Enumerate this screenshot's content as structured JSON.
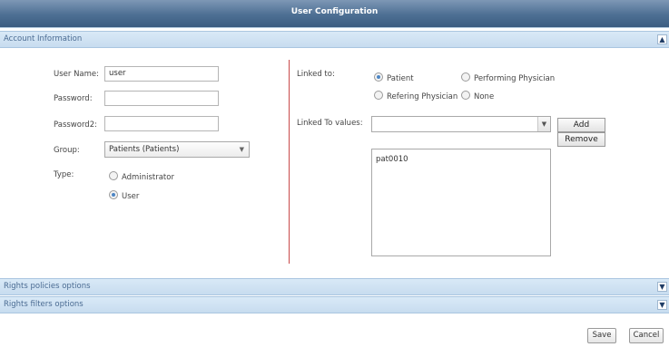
{
  "window": {
    "title": "User Configuration"
  },
  "sections": {
    "account": {
      "label": "Account Information",
      "chevron": "▲"
    },
    "rights_policies": {
      "label": "Rights policies options",
      "chevron": "▼"
    },
    "rights_filters": {
      "label": "Rights filters options",
      "chevron": "▼"
    }
  },
  "form": {
    "username_label": "User Name:",
    "username_value": "user",
    "password_label": "Password:",
    "password_value": "",
    "password2_label": "Password2:",
    "password2_value": "",
    "group_label": "Group:",
    "group_value": "Patients (Patients)",
    "type_label": "Type:",
    "type_options": [
      {
        "label": "Administrator",
        "selected": false
      },
      {
        "label": "User",
        "selected": true
      }
    ]
  },
  "linked": {
    "linked_to_label": "Linked to:",
    "options": [
      {
        "label": "Patient",
        "selected": true
      },
      {
        "label": "Performing Physician",
        "selected": false
      },
      {
        "label": "Refering Physician",
        "selected": false
      },
      {
        "label": "None",
        "selected": false
      }
    ],
    "values_label": "Linked To values:",
    "values_input": "",
    "add_label": "Add",
    "remove_label": "Remove",
    "list": [
      "pat0010"
    ]
  },
  "footer": {
    "save_label": "Save",
    "cancel_label": "Cancel"
  },
  "icons": {
    "dropdown": "chevron-down-icon",
    "collapse": "chevron-up-icon",
    "expand": "chevron-down-icon"
  }
}
